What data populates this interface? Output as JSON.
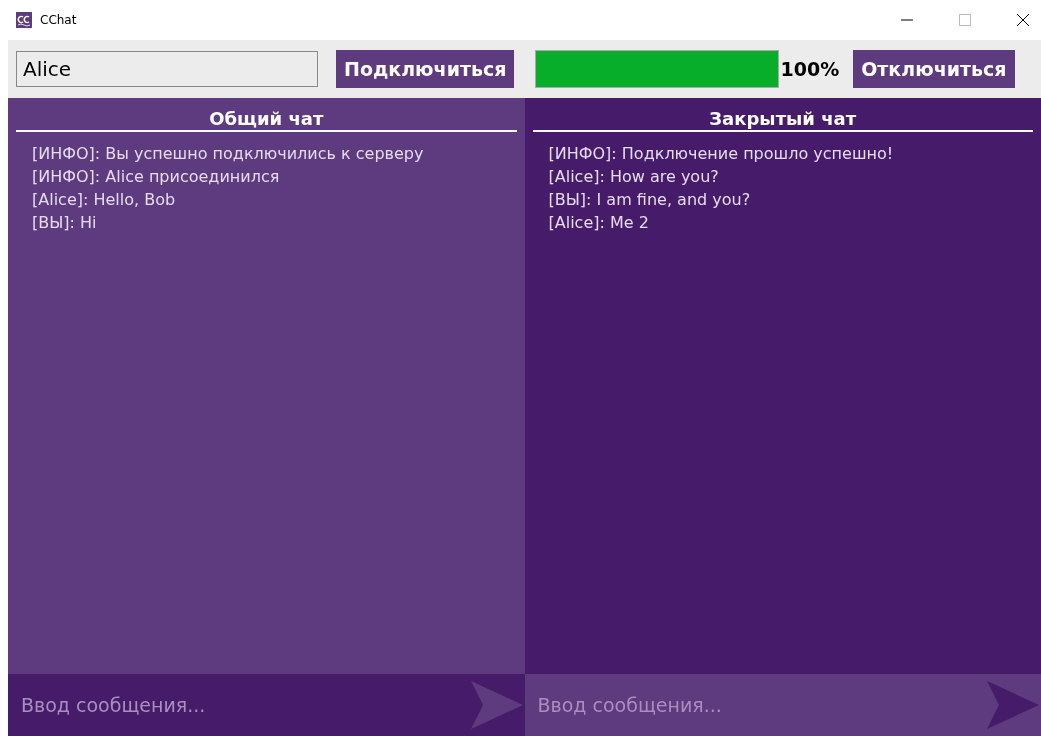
{
  "window": {
    "title": "CChat"
  },
  "toolbar": {
    "username": "Alice",
    "connect_button": "Подключиться",
    "progress": {
      "level": 1,
      "reading": "100%"
    },
    "disconnect_button": "Отключиться"
  },
  "chats": [
    {
      "title": "Общий чат",
      "messages": [
        "[ИНФО]: Вы успешно подключились к серверу",
        "[ИНФО]: Alice присоединился",
        "[Alice]: Hello, Bob",
        "[ВЫ]: Hi"
      ],
      "input": {
        "placeholder": "Ввод сообщения..."
      }
    },
    {
      "title": "Закрытый чат",
      "messages": [
        "[ИНФО]: Подключение прошло успешно!",
        "[Alice]: How are you?",
        "[ВЫ]: I am fine, and you?",
        "[Alice]: Me 2"
      ],
      "input": {
        "placeholder": "Ввод сообщения..."
      }
    }
  ]
}
